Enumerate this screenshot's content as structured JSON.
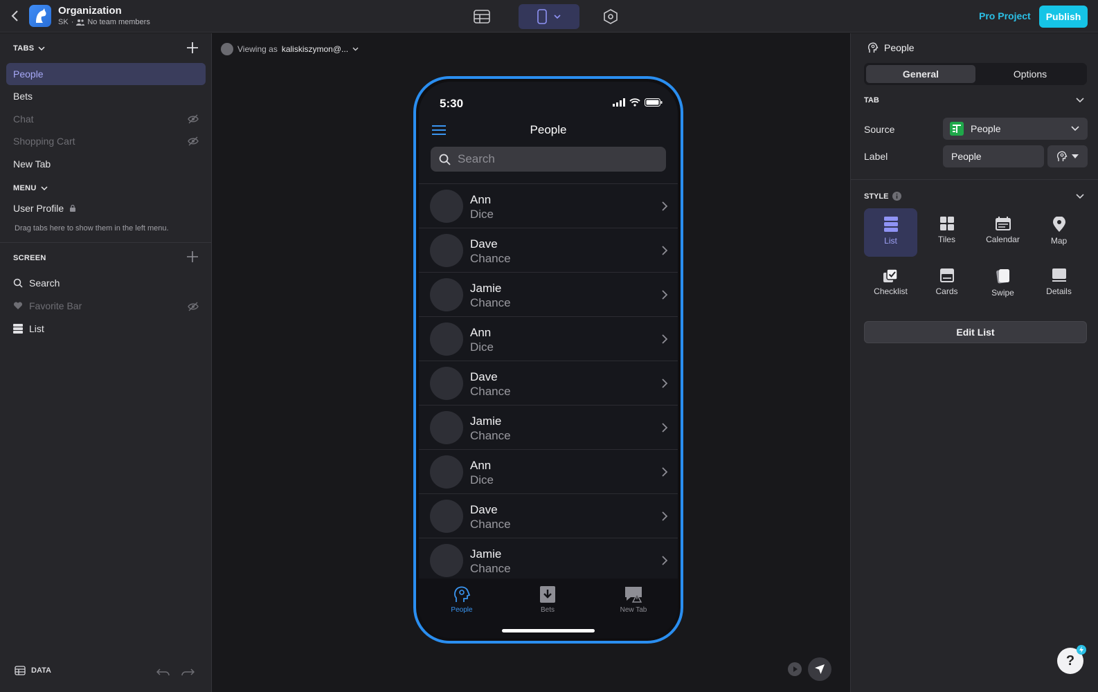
{
  "header": {
    "org_title": "Organization",
    "initials": "SK",
    "team": "No team members",
    "pro_project": "Pro Project",
    "publish": "Publish"
  },
  "left": {
    "tabs_heading": "TABS",
    "tabs": [
      {
        "label": "People",
        "state": "active"
      },
      {
        "label": "Bets",
        "state": "normal"
      },
      {
        "label": "Chat",
        "state": "hidden"
      },
      {
        "label": "Shopping Cart",
        "state": "hidden"
      },
      {
        "label": "New Tab",
        "state": "normal"
      }
    ],
    "menu_heading": "MENU",
    "menu_item": "User Profile",
    "hint": "Drag tabs here to show them in the left menu.",
    "screen_heading": "SCREEN",
    "screen_items": [
      {
        "label": "Search",
        "icon": "search-icon"
      },
      {
        "label": "Favorite Bar",
        "icon": "heart-icon"
      },
      {
        "label": "List",
        "icon": "list-icon"
      }
    ],
    "data": "DATA"
  },
  "canvas": {
    "viewing_as": "Viewing as",
    "viewer": "kaliskiszymon@..."
  },
  "phone": {
    "time": "5:30",
    "title": "People",
    "search_placeholder": "Search",
    "rows": [
      {
        "title": "Ann",
        "subtitle": "Dice"
      },
      {
        "title": "Dave",
        "subtitle": "Chance"
      },
      {
        "title": "Jamie",
        "subtitle": "Chance"
      },
      {
        "title": "Ann",
        "subtitle": "Dice"
      },
      {
        "title": "Dave",
        "subtitle": "Chance"
      },
      {
        "title": "Jamie",
        "subtitle": "Chance"
      },
      {
        "title": "Ann",
        "subtitle": "Dice"
      },
      {
        "title": "Dave",
        "subtitle": "Chance"
      },
      {
        "title": "Jamie",
        "subtitle": "Chance"
      }
    ],
    "tabbar": [
      {
        "label": "People",
        "active": true
      },
      {
        "label": "Bets",
        "active": false
      },
      {
        "label": "New Tab",
        "active": false
      }
    ]
  },
  "right": {
    "title": "People",
    "seg_general": "General",
    "seg_options": "Options",
    "tab_heading": "TAB",
    "source_label": "Source",
    "source_value": "People",
    "label_label": "Label",
    "label_value": "People",
    "style_heading": "STYLE",
    "styles": [
      "List",
      "Tiles",
      "Calendar",
      "Map",
      "Checklist",
      "Cards",
      "Swipe",
      "Details"
    ],
    "selected_style": "List",
    "edit_list": "Edit List",
    "help": "?"
  },
  "colors": {
    "accent": "#16c4e6",
    "phone_frame": "#2a8ef0",
    "active_tab": "#a7a9f7"
  }
}
